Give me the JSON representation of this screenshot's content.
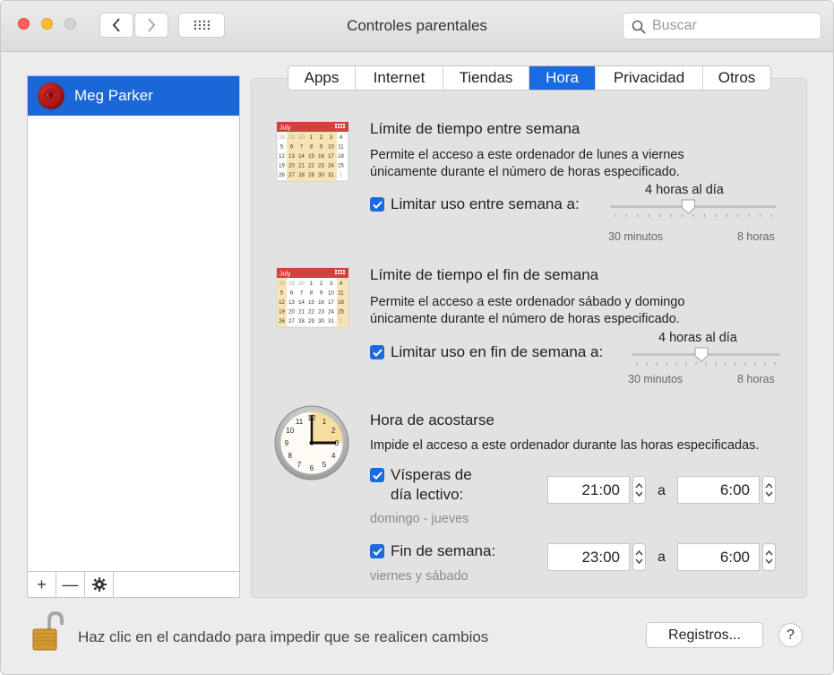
{
  "window": {
    "title": "Controles parentales"
  },
  "search": {
    "placeholder": "Buscar"
  },
  "users": [
    {
      "name": "Meg Parker",
      "selected": true
    }
  ],
  "list_footer": {
    "add": "+",
    "remove": "—"
  },
  "tabs": [
    {
      "label": "Apps",
      "active": false
    },
    {
      "label": "Internet",
      "active": false
    },
    {
      "label": "Tiendas",
      "active": false
    },
    {
      "label": "Hora",
      "active": true
    },
    {
      "label": "Privacidad",
      "active": false
    },
    {
      "label": "Otros",
      "active": false
    }
  ],
  "weekday": {
    "title": "Límite de tiempo entre semana",
    "description_1": "Permite el acceso a este ordenador de lunes a viernes",
    "description_2": "únicamente durante el número de horas especificado.",
    "checkbox_label": "Limitar uso entre semana a:",
    "checked": true,
    "value_label": "4 horas al día",
    "min_label": "30 minutos",
    "max_label": "8 horas",
    "slider_fraction": 0.47
  },
  "weekend": {
    "title": "Límite de tiempo el fin de semana",
    "description_1": "Permite el acceso a este ordenador sábado y domingo",
    "description_2": "únicamente durante el número de horas especificado.",
    "checkbox_label": "Limitar uso en fin de semana a:",
    "checked": true,
    "value_label": "4 horas al día",
    "min_label": "30 minutos",
    "max_label": "8 horas",
    "slider_fraction": 0.47
  },
  "bedtime": {
    "title": "Hora de acostarse",
    "description": "Impide el acceso a este ordenador durante las horas especificadas.",
    "school_nights": {
      "label_1": "Vísperas de",
      "label_2": "día lectivo:",
      "checked": true,
      "days": "domingo - jueves",
      "from": "21:00",
      "sep": "a",
      "to": "6:00"
    },
    "weekend": {
      "label": "Fin de semana:",
      "checked": true,
      "days": "viernes y sábado",
      "from": "23:00",
      "sep": "a",
      "to": "6:00"
    }
  },
  "calendar": {
    "month": "July",
    "rows": [
      [
        "28",
        "29",
        "30",
        "1",
        "2",
        "3",
        "4"
      ],
      [
        "5",
        "6",
        "7",
        "8",
        "9",
        "10",
        "11"
      ],
      [
        "12",
        "13",
        "14",
        "15",
        "16",
        "17",
        "18"
      ],
      [
        "19",
        "20",
        "21",
        "22",
        "23",
        "24",
        "25"
      ],
      [
        "26",
        "27",
        "28",
        "29",
        "30",
        "31",
        "1"
      ]
    ]
  },
  "clock": {
    "numbers": [
      "12",
      "1",
      "2",
      "3",
      "4",
      "5",
      "6",
      "7",
      "8",
      "9",
      "10",
      "11"
    ]
  },
  "footer": {
    "lock_text": "Haz clic en el candado para impedir que se realicen cambios",
    "logs_button": "Registros...",
    "help_button": "?"
  },
  "colors": {
    "accent": "#1a6ae0",
    "selection": "#1a68d8"
  }
}
